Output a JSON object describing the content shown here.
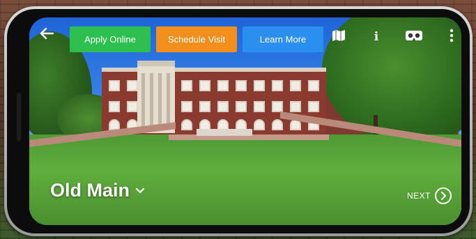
{
  "topbar": {
    "back_icon": "arrow-left-icon",
    "buttons": [
      {
        "label": "Apply Online",
        "color": "#2dbf4f"
      },
      {
        "label": "Schedule Visit",
        "color": "#f28f1c"
      },
      {
        "label": "Learn More",
        "color": "#2b8ff0"
      }
    ],
    "tools": [
      "map-icon",
      "info-icon",
      "vr-headset-icon",
      "more-vertical-icon"
    ],
    "info_glyph": "i"
  },
  "location": {
    "title": "Old Main",
    "dropdown_icon": "chevron-down-icon"
  },
  "navigation": {
    "next_label": "NEXT",
    "next_icon": "chevron-right-circle-icon"
  }
}
